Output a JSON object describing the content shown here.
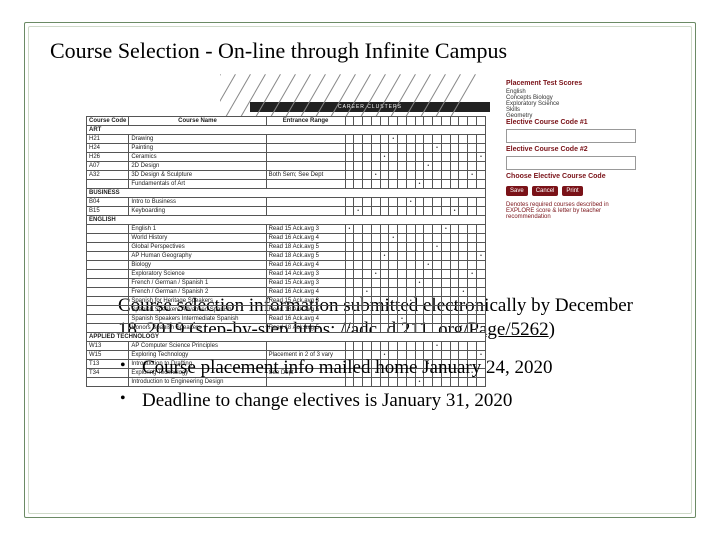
{
  "title": "Course Selection -  On-line through Infinite Campus",
  "chart": {
    "cluster_band": "CAREER CLUSTERS",
    "column_headers": [
      "Course Code",
      "Course Name",
      "Entrance Range"
    ],
    "side": {
      "header": "Placement Test Scores",
      "lines": [
        "English",
        "Concepts Biology",
        "Exploratory Science",
        "Skills",
        "Geometry"
      ],
      "label1": "Elective Course Code #1",
      "label2": "Elective Course Code #2",
      "label3": "Choose Elective Course Code",
      "buttons": [
        "Save",
        "Cancel",
        "Print"
      ],
      "note": "Denotes required courses described in EXPLORE score & letter by teacher recommendation"
    },
    "rows": [
      {
        "section": "ART"
      },
      {
        "code": "H21",
        "name": "Drawing",
        "range": ""
      },
      {
        "code": "H24",
        "name": "Painting",
        "range": ""
      },
      {
        "code": "H26",
        "name": "Ceramics",
        "range": ""
      },
      {
        "code": "A07",
        "name": "2D Design",
        "range": ""
      },
      {
        "code": "A32",
        "name": "3D Design & Sculpture",
        "range": "Both Sem; See Dept"
      },
      {
        "code": "",
        "name": "Fundamentals of Art",
        "range": ""
      },
      {
        "section": "BUSINESS"
      },
      {
        "code": "B04",
        "name": "Intro to Business",
        "range": ""
      },
      {
        "code": "B15",
        "name": "Keyboarding",
        "range": ""
      },
      {
        "section": "ENGLISH"
      },
      {
        "code": "",
        "name": "English 1",
        "range": "Read 15   Ack.avg 3"
      },
      {
        "code": "",
        "name": "World History",
        "range": "Read 16   Ack.avg 4"
      },
      {
        "code": "",
        "name": "Global Perspectives",
        "range": "Read 18   Ack.avg 5"
      },
      {
        "code": "",
        "name": "AP Human Geography",
        "range": "Read 18   Ack.avg 5"
      },
      {
        "code": "",
        "name": "Biology",
        "range": "Read 16   Ack.avg 4"
      },
      {
        "code": "",
        "name": "Exploratory Science",
        "range": "Read 14   Ack.avg 3"
      },
      {
        "code": "",
        "name": "French / German / Spanish 1",
        "range": "Read 15   Ack.avg 3"
      },
      {
        "code": "",
        "name": "French / German / Spanish 2",
        "range": "Read 16   Ack.avg 4"
      },
      {
        "code": "",
        "name": "Spanish for Heritage Speakers",
        "range": "Read 15   Ack.avg 3"
      },
      {
        "code": "",
        "name": "Spanish Speakers Advanced Spanish",
        "range": "Read 18   Ack.avg 5"
      },
      {
        "code": "",
        "name": "Spanish Speakers Intermediate Spanish",
        "range": "Read 16   Ack.avg 4"
      },
      {
        "code": "",
        "name": "Honors Spanish Speakers",
        "range": "Read 18   Ack.avg 5"
      },
      {
        "section": "APPLIED TECHNOLOGY"
      },
      {
        "code": "W13",
        "name": "AP Computer Science Principles",
        "range": ""
      },
      {
        "code": "W15",
        "name": "Exploring Technology",
        "range": "Placement in 2 of 3 vary"
      },
      {
        "code": "T13",
        "name": "Introduction to Drafting",
        "range": ""
      },
      {
        "code": "T34",
        "name": "Exploring Technology",
        "range": "See Dept"
      },
      {
        "code": "",
        "name": "Introduction to Engineering Design",
        "range": ""
      }
    ]
  },
  "body": {
    "para_pre": "Course selection information submitted electronically by December 18, 2019 (step-by-step ",
    "link_text": "https: //adc. d 211. org/Page/5262",
    "link_href": "https://adc.d211.org/Page/5262",
    "para_post": ")"
  },
  "bullets": [
    "Course placement info mailed home January  24, 2020",
    "Deadline to change electives is January 31, 2020"
  ]
}
